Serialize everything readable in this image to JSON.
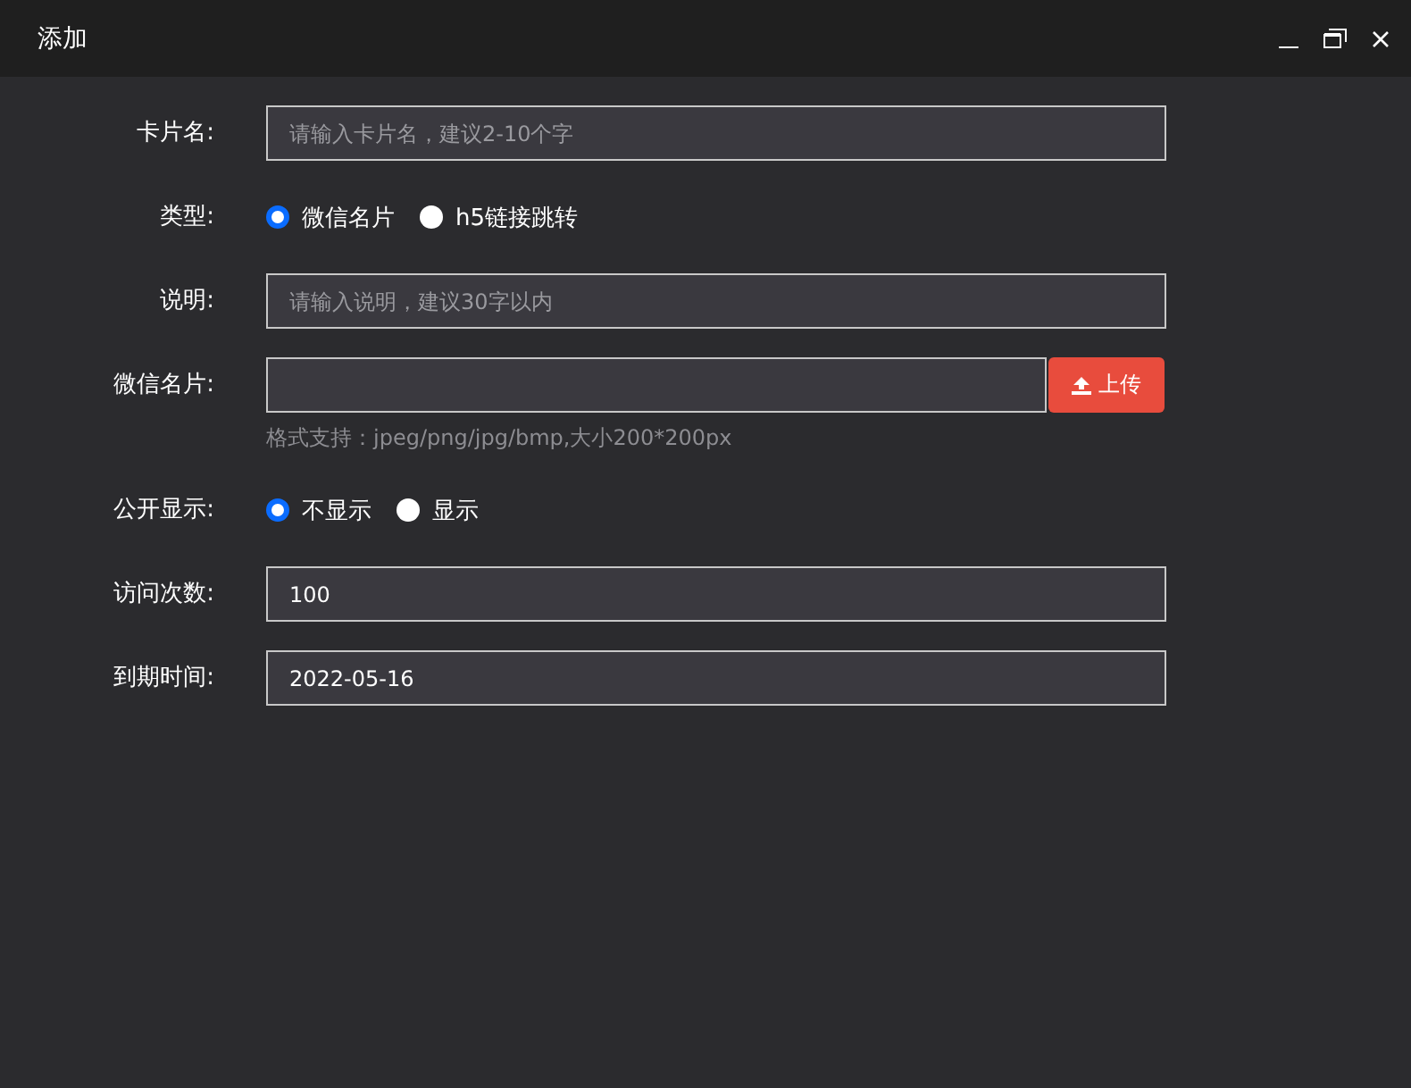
{
  "window": {
    "title": "添加"
  },
  "fields": [
    {
      "kind": "text",
      "label": "卡片名:",
      "placeholder": "请输入卡片名，建议2-10个字"
    },
    {
      "kind": "radio",
      "label": "类型:",
      "options": [
        {
          "label": "微信名片",
          "selected": true
        },
        {
          "label": "h5链接跳转",
          "selected": false
        }
      ]
    },
    {
      "kind": "text",
      "label": "说明:",
      "placeholder": "请输入说明，建议30字以内"
    },
    {
      "kind": "upload",
      "label": "微信名片:",
      "button": "上传",
      "hint": "格式支持：jpeg/png/jpg/bmp,大小200*200px"
    },
    {
      "kind": "radio",
      "label": "公开显示:",
      "options": [
        {
          "label": "不显示",
          "selected": true
        },
        {
          "label": "显示",
          "selected": false
        }
      ]
    },
    {
      "kind": "text",
      "label": "访问次数:",
      "value": "100"
    },
    {
      "kind": "text",
      "label": "到期时间:",
      "value": "2022-05-16"
    }
  ]
}
